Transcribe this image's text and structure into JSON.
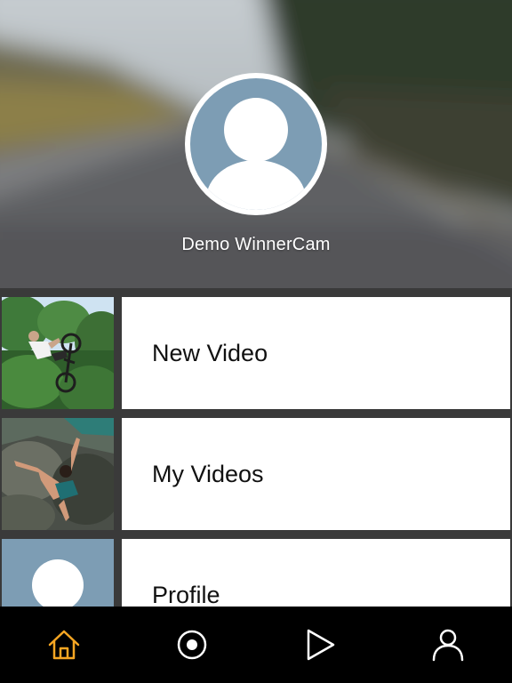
{
  "profile": {
    "name": "Demo WinnerCam"
  },
  "menu": {
    "items": [
      {
        "label": "New Video",
        "thumbnail": "bmx-rider-photo"
      },
      {
        "label": "My Videos",
        "thumbnail": "climber-photo"
      },
      {
        "label": "Profile",
        "thumbnail": "default-avatar"
      }
    ]
  },
  "tabbar": {
    "tabs": [
      {
        "icon": "home-icon",
        "active": true
      },
      {
        "icon": "record-icon",
        "active": false
      },
      {
        "icon": "play-icon",
        "active": false
      },
      {
        "icon": "user-icon",
        "active": false
      }
    ]
  },
  "colors": {
    "accent": "#f5a623",
    "avatar_bg": "#7d9db4",
    "tabbar_bg": "#000000",
    "divider": "#3a3a3a",
    "icon_default": "#ffffff"
  }
}
